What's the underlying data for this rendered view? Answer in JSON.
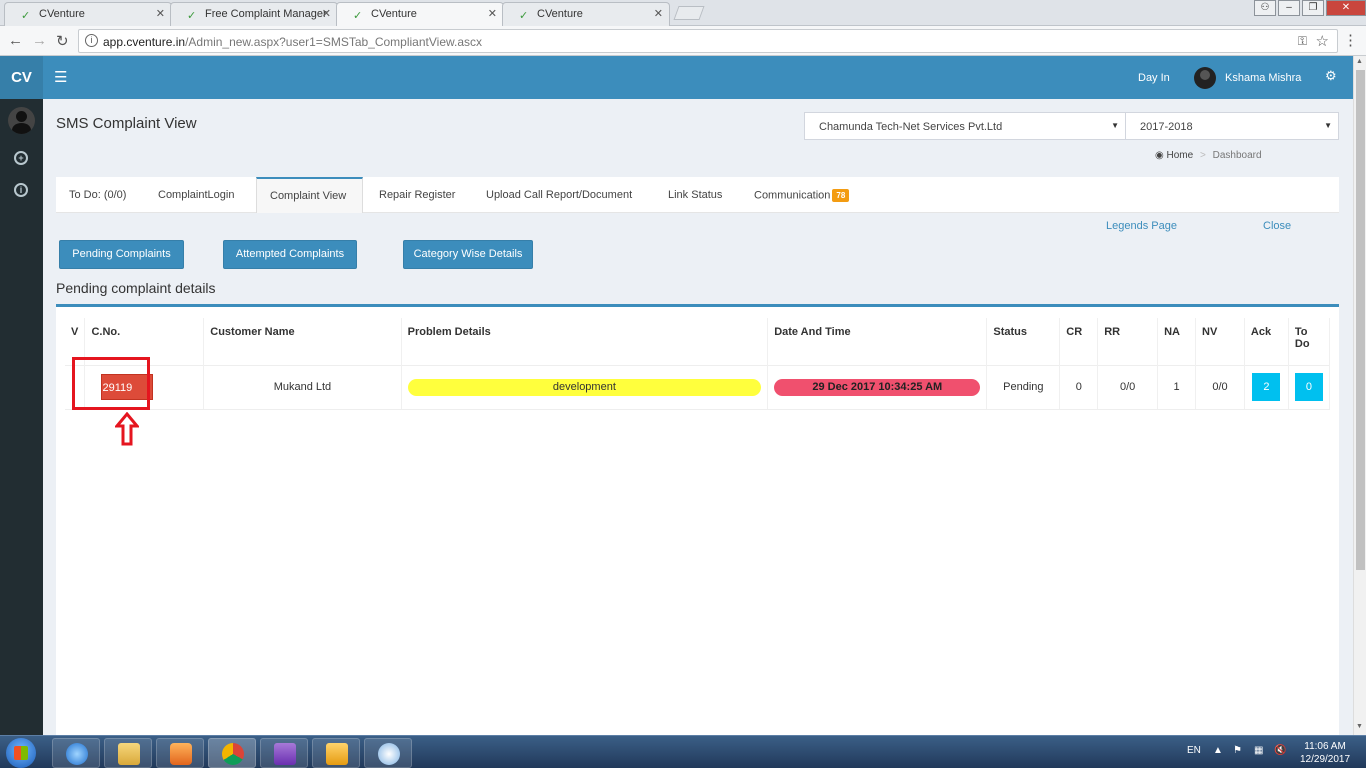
{
  "browser": {
    "tabs": [
      {
        "title": "CVenture",
        "active": false
      },
      {
        "title": "Free Complaint Manager",
        "active": false
      },
      {
        "title": "CVenture",
        "active": true
      },
      {
        "title": "CVenture",
        "active": false
      }
    ],
    "url_host": "app.cventure.in",
    "url_path": "/Admin_new.aspx?user1=SMSTab_CompliantView.ascx"
  },
  "header": {
    "logo": "CV",
    "day_in": "Day In",
    "user_name": "Kshama Mishra"
  },
  "page": {
    "title": "SMS Complaint View",
    "company_select": "Chamunda Tech-Net Services Pvt.Ltd",
    "year_select": "2017-2018",
    "breadcrumb": {
      "home": "Home",
      "current": "Dashboard"
    }
  },
  "tabs": [
    {
      "label": "To Do: (0/0)"
    },
    {
      "label": "ComplaintLogin"
    },
    {
      "label": "Complaint View"
    },
    {
      "label": "Repair Register"
    },
    {
      "label": "Upload Call Report/Document"
    },
    {
      "label": "Link Status"
    },
    {
      "label": "Communication",
      "badge": "78"
    }
  ],
  "links": {
    "legends": "Legends Page",
    "close": "Close"
  },
  "buttons": {
    "pending": "Pending Complaints",
    "attempted": "Attempted Complaints",
    "category": "Category Wise Details"
  },
  "section_title": "Pending complaint details",
  "table": {
    "headers": [
      "V",
      "C.No.",
      "Customer Name",
      "Problem Details",
      "Date And Time",
      "Status",
      "CR",
      "RR",
      "NA",
      "NV",
      "Ack",
      "To Do"
    ],
    "rows": [
      {
        "v": "",
        "cno": "29119",
        "customer": "Mukand Ltd",
        "problem": "development",
        "datetime": "29 Dec 2017 10:34:25 AM",
        "status": "Pending",
        "cr": "0",
        "rr": "0/0",
        "na": "1",
        "nv": "0/0",
        "ack": "2",
        "todo": "0"
      }
    ]
  },
  "taskbar": {
    "lang": "EN",
    "time": "11:06 AM",
    "date": "12/29/2017"
  },
  "colors": {
    "header": "#3c8dbc",
    "sidebar": "#222d32",
    "cno_button": "#dd4b39",
    "problem_pill": "#ffff3d",
    "date_pill": "#f0506e",
    "ack_button": "#00c0ef",
    "highlight": "#e5151f"
  }
}
